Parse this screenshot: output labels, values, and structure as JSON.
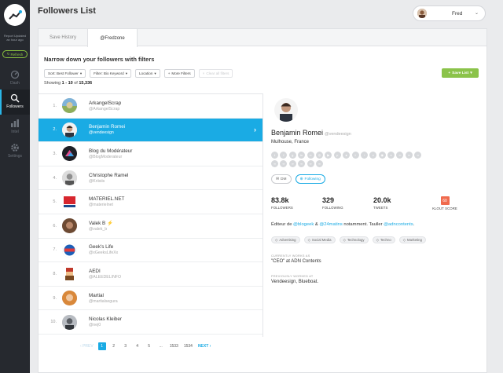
{
  "sidebar": {
    "report_line1": "Report Updated",
    "report_line2": "an hour ago",
    "refresh_label": "Refresh",
    "nav": [
      {
        "label": "Dash",
        "icon": "dashboard-icon"
      },
      {
        "label": "Followers",
        "icon": "followers-icon"
      },
      {
        "label": "Intel",
        "icon": "bar-chart-icon"
      },
      {
        "label": "Settings",
        "icon": "gear-icon"
      }
    ]
  },
  "header": {
    "title": "Followers List",
    "user_name": "Fred"
  },
  "tabs": [
    {
      "label": "Save History"
    },
    {
      "label": "@Fredzone"
    }
  ],
  "filters": {
    "heading": "Narrow down your followers with filters",
    "sort_label": "Sort: Best Follower",
    "bio_label": "Filter: Bio Keyword",
    "location_label": "Location",
    "more_label": "More Filters",
    "clear_label": "Clear all filters",
    "save_label": "Save List"
  },
  "showing": {
    "prefix": "Showing ",
    "range": "1 - 10",
    "of": " of ",
    "total": "15,336"
  },
  "followers": [
    {
      "num": "1.",
      "name": "ArkangelScrap",
      "handle": "@ArkangelScrap"
    },
    {
      "num": "2.",
      "name": "Benjamin Romei",
      "handle": "@vendeesign"
    },
    {
      "num": "3.",
      "name": "Blog du Modérateur",
      "handle": "@BlogModerateur"
    },
    {
      "num": "4.",
      "name": "Christophe Ramel",
      "handle": "@Kriisiis"
    },
    {
      "num": "5.",
      "name": "MATERIEL.NET",
      "handle": "@materielnet"
    },
    {
      "num": "6.",
      "name": "Valek B ⚡",
      "handle": "@valek_b"
    },
    {
      "num": "7.",
      "name": "Geek's Life",
      "handle": "@xGeeksLifeXx"
    },
    {
      "num": "8.",
      "name": "AEDI",
      "handle": "@ALEEDELINFO"
    },
    {
      "num": "9.",
      "name": "Martial",
      "handle": "@martialsegura"
    },
    {
      "num": "10.",
      "name": "Nicolas Kleiber",
      "handle": "@nej0"
    }
  ],
  "pagination": {
    "prev": "PREV",
    "pages": [
      "1",
      "2",
      "3",
      "4",
      "5",
      "...",
      "1533",
      "1534"
    ],
    "next": "NEXT"
  },
  "detail": {
    "name": "Benjamin Romei",
    "handle": "@vendeesign",
    "location": "Mulhouse, France",
    "dm_label": "DM",
    "following_label": "Following",
    "followers_value": "83.8k",
    "followers_label": "FOLLOWERS",
    "following_value": "329",
    "following_stat_label": "FOLLOWING",
    "tweets_value": "20.0k",
    "tweets_label": "TWEETS",
    "klout_value": "60",
    "klout_label": "KLOUT SCORE",
    "bio_1": "Éditeur de ",
    "bio_link1": "@blogeek",
    "bio_2": " & ",
    "bio_link2": "@24matins",
    "bio_3": " notamment. Tauller ",
    "bio_link3": "@adncontents",
    "bio_4": ".",
    "tags": [
      "Advertising",
      "Social Media",
      "Technology",
      "Techno",
      "Marketing"
    ],
    "currently_heading": "CURRENTLY WORKS AS",
    "currently_value": "\"CEO\" at ADN Contents",
    "previously_heading": "PREVIOUSLY WORKED AT",
    "previously_value": "Vendeesign, Blueboat."
  },
  "colors": {
    "accent": "#1aabe4",
    "save_green": "#8bc34a",
    "sidebar": "#26292f",
    "klout": "#f06b4e"
  }
}
